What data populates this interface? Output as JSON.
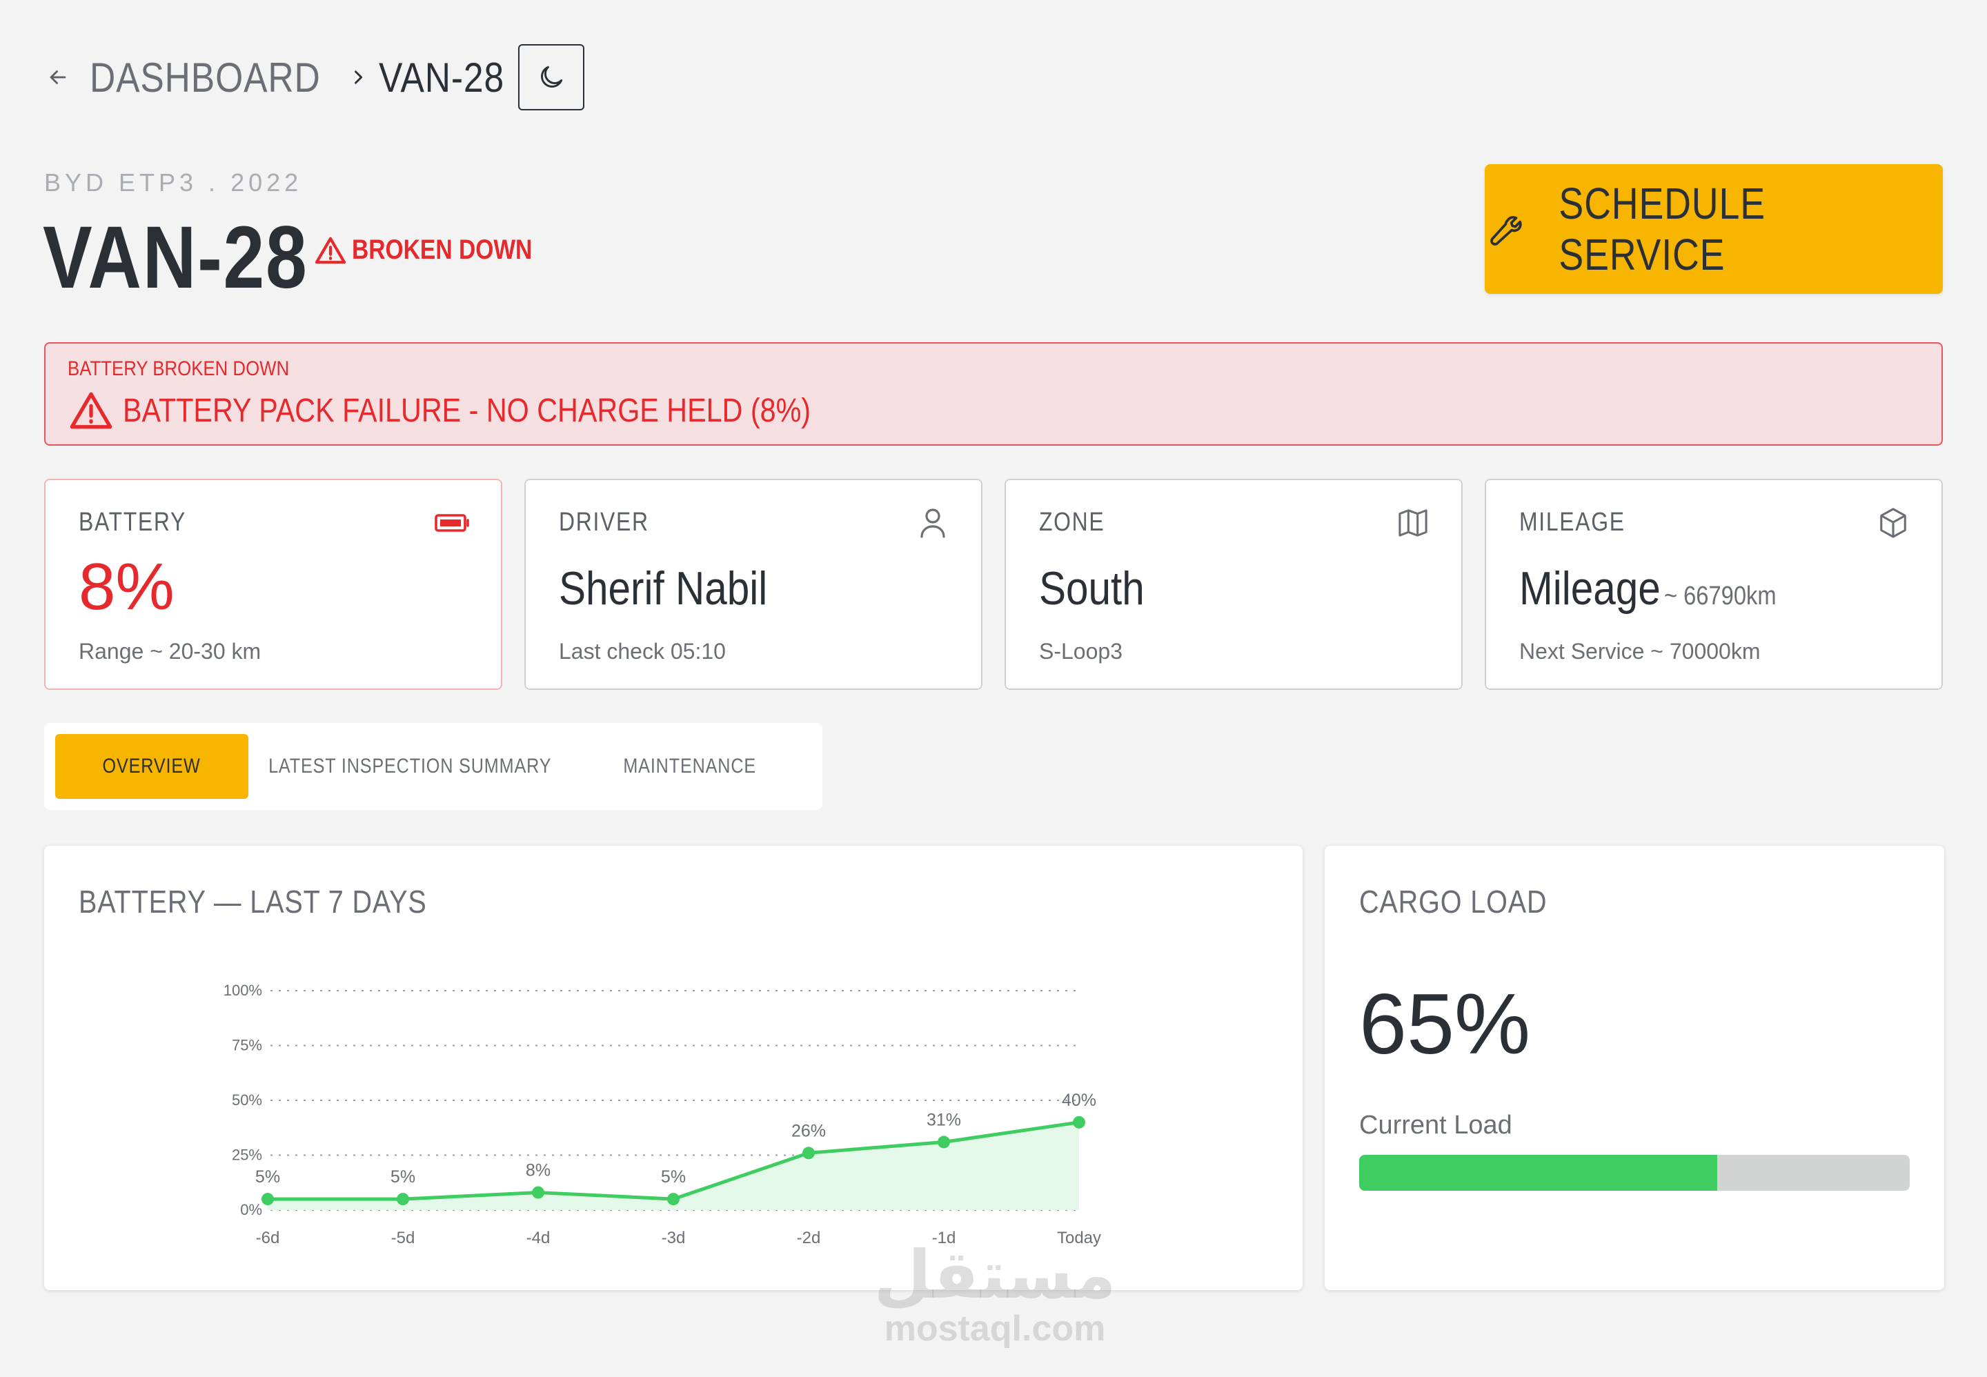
{
  "breadcrumb": {
    "parent": "DASHBOARD",
    "current": "VAN-28"
  },
  "header": {
    "model": "BYD ETP3 . 2022",
    "title": "VAN-28",
    "status": "BROKEN DOWN",
    "action_label": "SCHEDULE SERVICE"
  },
  "alert": {
    "label": "BATTERY BROKEN DOWN",
    "message": "BATTERY PACK FAILURE - NO CHARGE HELD (8%)"
  },
  "cards": {
    "battery": {
      "label": "BATTERY",
      "value": "8%",
      "sub": "Range ~ 20-30 km",
      "icon": "battery-icon"
    },
    "driver": {
      "label": "DRIVER",
      "value": "Sherif Nabil",
      "sub": "Last check 05:10",
      "icon": "user-icon"
    },
    "zone": {
      "label": "ZONE",
      "value": "South",
      "sub": "S-Loop3",
      "icon": "map-icon"
    },
    "mileage": {
      "label": "MILEAGE",
      "value": "Mileage",
      "aside": "~ 66790km",
      "sub": "Next Service ~ 70000km",
      "icon": "box-icon"
    }
  },
  "tabs": [
    "OVERVIEW",
    "LATEST INSPECTION SUMMARY",
    "MAINTENANCE"
  ],
  "active_tab": 0,
  "battery_panel": {
    "title": "BATTERY — LAST 7 DAYS"
  },
  "chart_data": {
    "type": "area",
    "categories": [
      "-6d",
      "-5d",
      "-4d",
      "-3d",
      "-2d",
      "-1d",
      "Today"
    ],
    "values": [
      5,
      5,
      8,
      5,
      26,
      31,
      40
    ],
    "data_labels": [
      "5%",
      "5%",
      "8%",
      "5%",
      "26%",
      "31%",
      "40%"
    ],
    "y_ticks": [
      "0%",
      "25%",
      "50%",
      "75%",
      "100%"
    ],
    "ylim": [
      0,
      100
    ],
    "grid": true,
    "colors": {
      "line": "#3fcc61",
      "fill": "#e4f8e9"
    }
  },
  "cargo": {
    "title": "CARGO LOAD",
    "value": "65%",
    "sub": "Current Load",
    "fraction": 0.65
  },
  "watermark": {
    "arabic": "مستقل",
    "latin": "mostaql.com"
  },
  "colors": {
    "accent": "#f7b500",
    "danger": "#e5292c",
    "success": "#3fcc61"
  }
}
